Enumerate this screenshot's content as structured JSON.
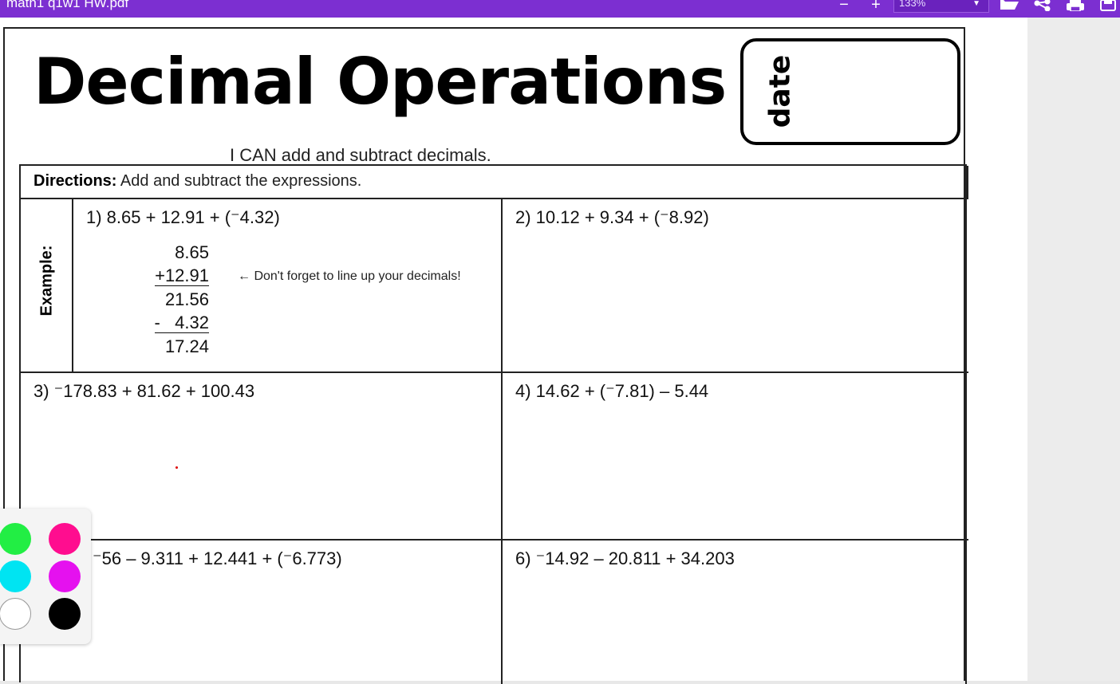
{
  "toolbar": {
    "title": "math1 q1w1 HW.pdf",
    "zoom": "133%",
    "minus": "−",
    "plus": "+"
  },
  "worksheet": {
    "title": "Decimal Operations",
    "subtitle": "I CAN add and subtract decimals.",
    "date_label": "date",
    "directions_label": "Directions:",
    "directions_text": " Add and subtract the expressions.",
    "example_label": "Example:",
    "problems": [
      "1)  8.65 + 12.91 + (⁻4.32)",
      "2)  10.12 + 9.34 + (⁻8.92)",
      "3)   ⁻178.83 + 81.62 + 100.43",
      "4) 14.62 + (⁻7.81) – 5.44",
      "⁻56 – 9.311 + 12.441 + (⁻6.773)",
      "6)  ⁻14.92 – 20.811 + 34.203"
    ],
    "example_work": [
      "8.65",
      "+12.91",
      "21.56",
      "-   4.32",
      "17.24"
    ],
    "example_note": "←  Don't forget to line up your decimals!"
  },
  "palette": {
    "colors": [
      "#22ee44",
      "#ff0d8f",
      "#00e4f2",
      "#e511ef",
      "#ffffff",
      "#000000"
    ]
  }
}
